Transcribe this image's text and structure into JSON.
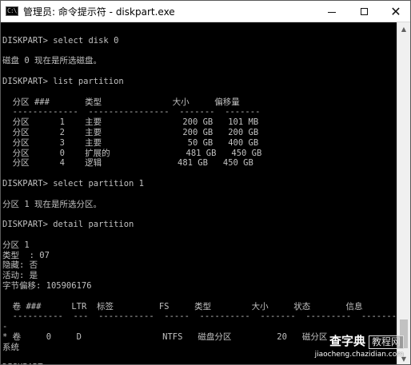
{
  "window": {
    "title": "管理员: 命令提示符 - diskpart.exe",
    "icon_label": "C:\\",
    "controls": {
      "minimize": "minimize-icon",
      "maximize": "maximize-icon",
      "close_symbol": "✕"
    }
  },
  "console": {
    "lines": [
      "",
      "DISKPART> select disk 0",
      "",
      "磁盘 0 现在是所选磁盘。",
      "",
      "DISKPART> list partition",
      "",
      "  分区 ###       类型              大小     偏移量",
      "  -------------  ----------------  -------  -------",
      "  分区      1    主要                200 GB   101 MB",
      "  分区      2    主要                200 GB   200 GB",
      "  分区      3    主要                 50 GB   400 GB",
      "  分区      0    扩展的               481 GB   450 GB",
      "  分区      4    逻辑               481 GB   450 GB",
      "",
      "DISKPART> select partition 1",
      "",
      "分区 1 现在是所选分区。",
      "",
      "DISKPART> detail partition",
      "",
      "分区 1",
      "类型  : 07",
      "隐藏: 否",
      "活动: 是",
      "字节偏移: 105906176",
      "",
      "  卷 ###      LTR  标签         FS     类型        大小     状态       信息",
      "  ----------  ---  -----------  -----  ----------  -------  ---------  --------",
      "-",
      "* 卷     0     D                NTFS   磁盘分区         20   磁分区",
      "系统",
      "",
      "DISKPART> "
    ]
  },
  "scrollbar": {
    "up_arrow": "▲",
    "down_arrow": "▼"
  },
  "watermark": {
    "brand": "查字典",
    "tag": "教程网",
    "url": "jiaocheng.chazidian.com"
  }
}
